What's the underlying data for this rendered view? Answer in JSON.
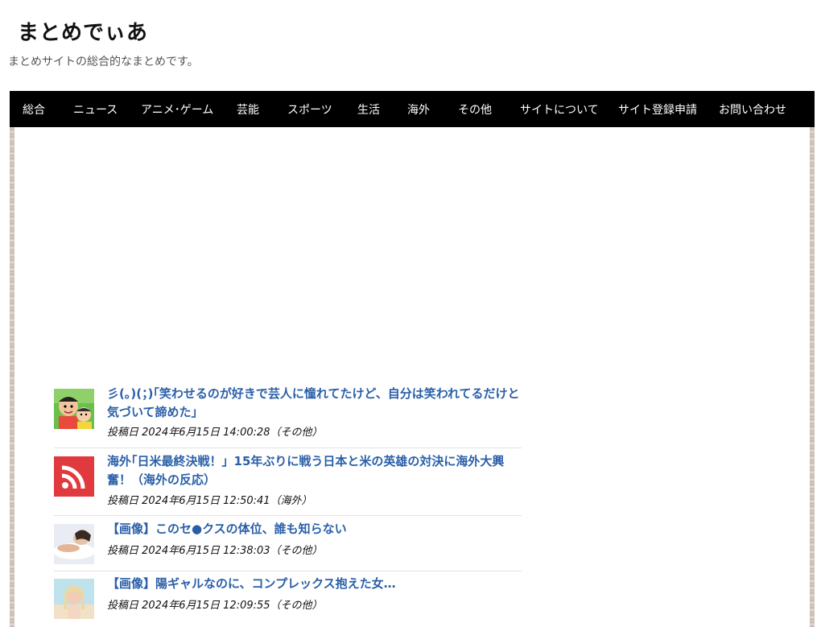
{
  "site": {
    "title": "まとめでぃあ",
    "description": "まとめサイトの総合的なまとめです。"
  },
  "nav": [
    "総合",
    "ニュース",
    "アニメ･ゲーム",
    "芸能",
    "スポーツ",
    "生活",
    "海外",
    "その他",
    "サイトについて",
    "サイト登録申請",
    "お問い合わせ"
  ],
  "posts": [
    {
      "title": "彡(｡)(；)｢笑わせるのが好きで芸人に憧れてたけど、自分は笑われてるだけと気づいて諦めた」",
      "meta": "投稿日 2024年6月15日 14:00:28（その他）",
      "thumb": "cartoon-avatar"
    },
    {
      "title": "海外｢日米最終決戦！」15年ぶりに戦う日本と米の英雄の対決に海外大興奮！（海外の反応）",
      "meta": "投稿日 2024年6月15日 12:50:41（海外）",
      "thumb": "rss-icon"
    },
    {
      "title": "【画像】このセ●クスの体位、誰も知らない",
      "meta": "投稿日 2024年6月15日 12:38:03（その他）",
      "thumb": "photo"
    },
    {
      "title": "【画像】陽ギャルなのに、コンプレックス抱えた女…",
      "meta": "投稿日 2024年6月15日 12:09:55（その他）",
      "thumb": "photo"
    }
  ],
  "colors": {
    "nav_bg": "#000000",
    "link": "#2a5fa8",
    "rss_red": "#e0393e"
  }
}
